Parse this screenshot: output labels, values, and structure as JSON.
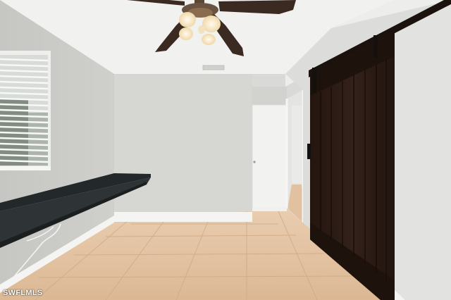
{
  "photo": {
    "watermark": "SWFLMLS",
    "colors": {
      "ceiling": "#f1f1f0",
      "wall_left": "#c9c9c6",
      "wall_back": "#d6d6d3",
      "wall_right": "#dcdcda",
      "floor_tile": "#e3c3a3",
      "grout": "#cfae8d",
      "baseboard": "#f4f4f2",
      "barn_door": "#2b1a14",
      "desk_top": "#2a2e30",
      "fan_blade": "#3a2a22",
      "light_glass": "#f6e7c8"
    },
    "icons": [
      "ceiling-fan-icon",
      "window-blinds-icon",
      "barn-door-icon",
      "interior-door-icon",
      "floating-desk-icon",
      "ceiling-vent-icon"
    ]
  }
}
